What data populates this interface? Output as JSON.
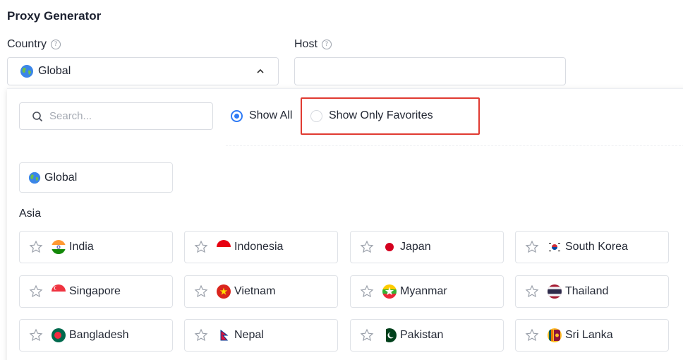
{
  "page": {
    "title": "Proxy Generator"
  },
  "country": {
    "label": "Country",
    "help": "?",
    "selected": "Global"
  },
  "host": {
    "label": "Host",
    "help": "?",
    "value": ""
  },
  "dropdown": {
    "search_placeholder": "Search...",
    "radio_show_all": "Show All",
    "radio_show_favorites": "Show Only Favorites",
    "selected_radio": "Show All",
    "global_option": "Global",
    "region": "Asia",
    "countries": [
      {
        "name": "India",
        "flag": "india-flag"
      },
      {
        "name": "Indonesia",
        "flag": "indonesia-flag"
      },
      {
        "name": "Japan",
        "flag": "japan-flag"
      },
      {
        "name": "South Korea",
        "flag": "south-korea-flag"
      },
      {
        "name": "Singapore",
        "flag": "singapore-flag"
      },
      {
        "name": "Vietnam",
        "flag": "vietnam-flag"
      },
      {
        "name": "Myanmar",
        "flag": "myanmar-flag"
      },
      {
        "name": "Thailand",
        "flag": "thailand-flag"
      },
      {
        "name": "Bangladesh",
        "flag": "bangladesh-flag"
      },
      {
        "name": "Nepal",
        "flag": "nepal-flag"
      },
      {
        "name": "Pakistan",
        "flag": "pakistan-flag"
      },
      {
        "name": "Sri Lanka",
        "flag": "sri-lanka-flag"
      }
    ]
  },
  "colors": {
    "accent": "#2f7bf5",
    "highlight": "#e03a31"
  }
}
